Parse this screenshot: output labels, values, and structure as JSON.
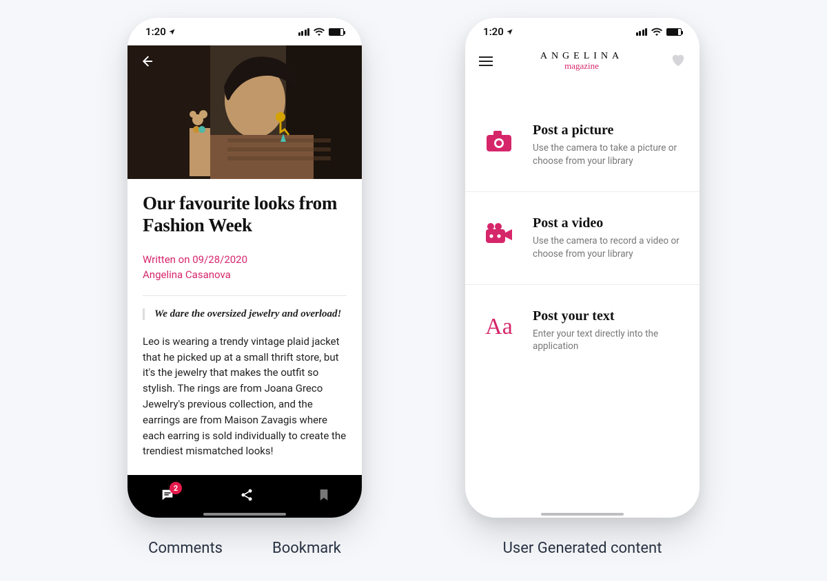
{
  "statusbar": {
    "time": "1:20"
  },
  "phone1": {
    "article": {
      "title": "Our favourite looks from Fashion Week",
      "date_line": "Written on 09/28/2020",
      "author": "Angelina Casanova",
      "quote": "We dare the oversized jewelry and overload!",
      "body": "Leo is wearing a trendy vintage plaid jacket that he picked up at a small thrift store, but it's the jewelry that makes the outfit so stylish. The rings are from Joana Greco Jewelry's previous collection, and the earrings are from Maison Zavagis where each earring is sold individually to create the trendiest mismatched looks!"
    },
    "bottombar": {
      "comments_badge": "2"
    },
    "captions": {
      "comments": "Comments",
      "bookmark": "Bookmark"
    }
  },
  "phone2": {
    "brand": {
      "line1": "ANGELINA",
      "line2": "magazine"
    },
    "items": [
      {
        "title": "Post a picture",
        "desc": "Use the camera to take a picture or choose from your library",
        "icon": "camera-icon"
      },
      {
        "title": "Post a video",
        "desc": "Use the camera to record a video or choose from your library",
        "icon": "video-camera-icon"
      },
      {
        "title": "Post your text",
        "desc": "Enter your text directly into the application",
        "icon": "text-aa-icon"
      }
    ],
    "caption": "User Generated content"
  }
}
